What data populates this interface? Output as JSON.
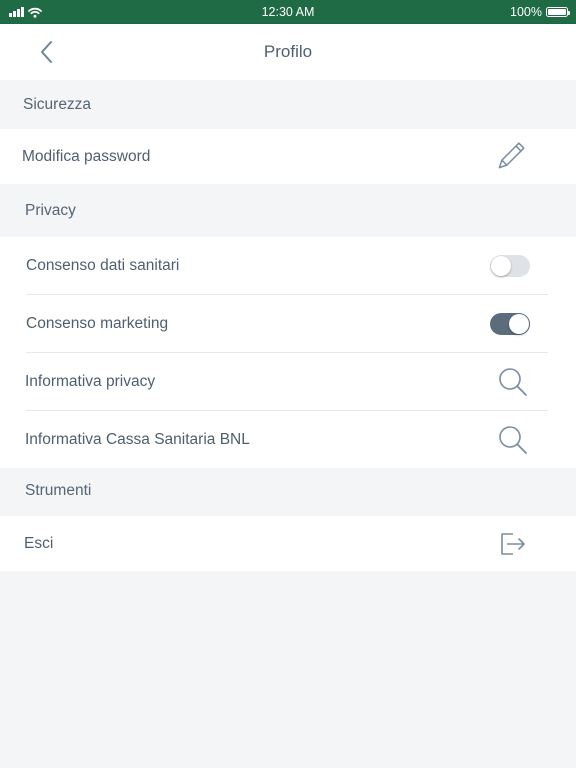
{
  "status_bar": {
    "time": "12:30 AM",
    "battery": "100%",
    "battery_level": 1.0,
    "icons": [
      "signal-icon",
      "wifi-icon",
      "battery-icon"
    ]
  },
  "nav": {
    "title": "Profilo",
    "back_icon": "chevron-left-icon"
  },
  "sections": {
    "security": {
      "header": "Sicurezza",
      "items": [
        {
          "label": "Modifica password",
          "icon": "pencil-icon"
        }
      ]
    },
    "privacy": {
      "header": "Privacy",
      "items": [
        {
          "label": "Consenso dati sanitari",
          "control": "toggle",
          "on": false
        },
        {
          "label": "Consenso marketing",
          "control": "toggle",
          "on": true
        },
        {
          "label": "Informativa privacy",
          "icon": "search-icon"
        },
        {
          "label": "Informativa Cassa Sanitaria BNL",
          "icon": "search-icon"
        }
      ]
    },
    "tools": {
      "header": "Strumenti",
      "items": [
        {
          "label": "Esci",
          "icon": "logout-icon"
        }
      ]
    }
  },
  "colors": {
    "status_bar": "#1e6b45",
    "background": "#f4f5f7",
    "text": "#4f5f6f",
    "icon": "#7b8da0",
    "toggle_on": "#5b6c7d",
    "toggle_off": "#dfe2e6"
  }
}
